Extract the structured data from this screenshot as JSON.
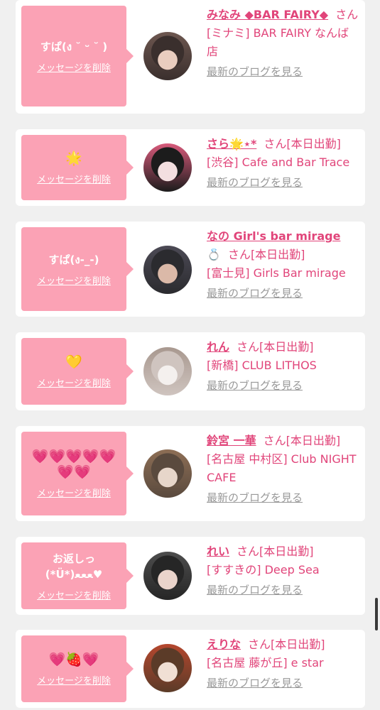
{
  "delete_label": "メッセージを削除",
  "blog_label": "最新のブログを見る",
  "san": "さん",
  "accent_color": "#e1457a",
  "bubble_color": "#fba2b5",
  "entries": [
    {
      "message": "すぱ(ง ˘ ᵕ ˘ )",
      "name": "みなみ ◆BAR FAIRY◆",
      "status": "",
      "shop": "[ミナミ] BAR FAIRY なんば店",
      "avatar_colors": [
        "#3a2f2d",
        "#e9cdbf",
        "#6d5750"
      ]
    },
    {
      "message": "🌟",
      "name": "さら🌟⋆*",
      "status": "[本日出勤]",
      "shop": "[渋谷] Cafe and Bar Trace",
      "avatar_colors": [
        "#1c1c1c",
        "#f3dfe0",
        "#d85a7b"
      ]
    },
    {
      "message": "すぱ(ง-_-)",
      "name": "なの Girl's bar mirage",
      "name_suffix": "💍",
      "status": "[本日出勤]",
      "shop": "[富士見] Girls Bar mirage",
      "avatar_colors": [
        "#2b2b2f",
        "#dbb9a8",
        "#4c4a55"
      ]
    },
    {
      "message": "💛",
      "name": "れん",
      "status": "[本日出勤]",
      "shop": "[新橋] CLUB LITHOS",
      "avatar_colors": [
        "#cfc4bf",
        "#f4f0ee",
        "#a8988f"
      ]
    },
    {
      "message": "💗💗💗💗💗💗💗",
      "name": "鈴宮 一華",
      "status": "[本日出勤]",
      "shop": "[名古屋 中村区] Club NIGHT CAFE",
      "avatar_colors": [
        "#5a4a3e",
        "#e7d6ca",
        "#8d6e55"
      ]
    },
    {
      "message": "お返しっ(*Ü*)ﻌﻌﻌ♥",
      "name": "れい",
      "status": "[本日出勤]",
      "shop": "[すすきの] Deep Sea",
      "avatar_colors": [
        "#262626",
        "#ead4cb",
        "#4d4d4d"
      ]
    },
    {
      "message": "💗🍓💗",
      "name": "えりな",
      "status": "[本日出勤]",
      "shop": "[名古屋 藤が丘] e star",
      "avatar_colors": [
        "#5b3b28",
        "#f0dfd4",
        "#b5472e"
      ]
    }
  ]
}
